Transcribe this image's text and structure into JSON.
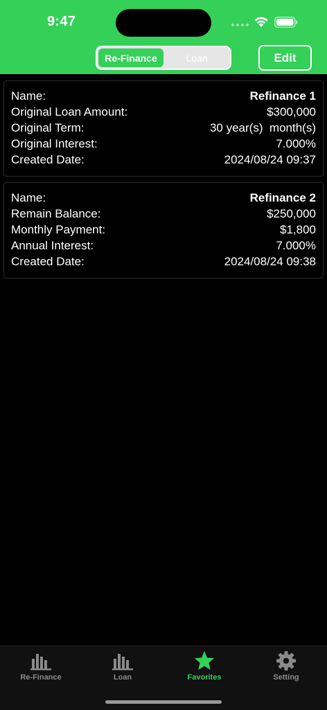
{
  "status_bar": {
    "time": "9:47"
  },
  "header": {
    "segments": [
      "Re-Finance",
      "Loan"
    ],
    "selected_segment": "Re-Finance",
    "edit_label": "Edit",
    "accent_color": "#34D058"
  },
  "cards": [
    {
      "rows": [
        {
          "label": "Name:",
          "value": "Refinance 1"
        },
        {
          "label": "Original Loan Amount:",
          "value": "$300,000"
        },
        {
          "label": "Original Term:",
          "value": "30 year(s)  month(s)"
        },
        {
          "label": "Original Interest:",
          "value": "7.000%"
        },
        {
          "label": "Created Date:",
          "value": "2024/08/24 09:37"
        }
      ]
    },
    {
      "rows": [
        {
          "label": "Name:",
          "value": "Refinance 2"
        },
        {
          "label": "Remain Balance:",
          "value": "$250,000"
        },
        {
          "label": "Monthly Payment:",
          "value": "$1,800"
        },
        {
          "label": "Annual Interest:",
          "value": "7.000%"
        },
        {
          "label": "Created Date:",
          "value": "2024/08/24 09:38"
        }
      ]
    }
  ],
  "tabbar": {
    "tabs": [
      {
        "label": "Re-Finance",
        "icon": "bar-chart-icon"
      },
      {
        "label": "Loan",
        "icon": "bar-chart-icon"
      },
      {
        "label": "Favorites",
        "icon": "star-icon"
      },
      {
        "label": "Setting",
        "icon": "gear-icon"
      }
    ],
    "active_tab": "Favorites"
  }
}
